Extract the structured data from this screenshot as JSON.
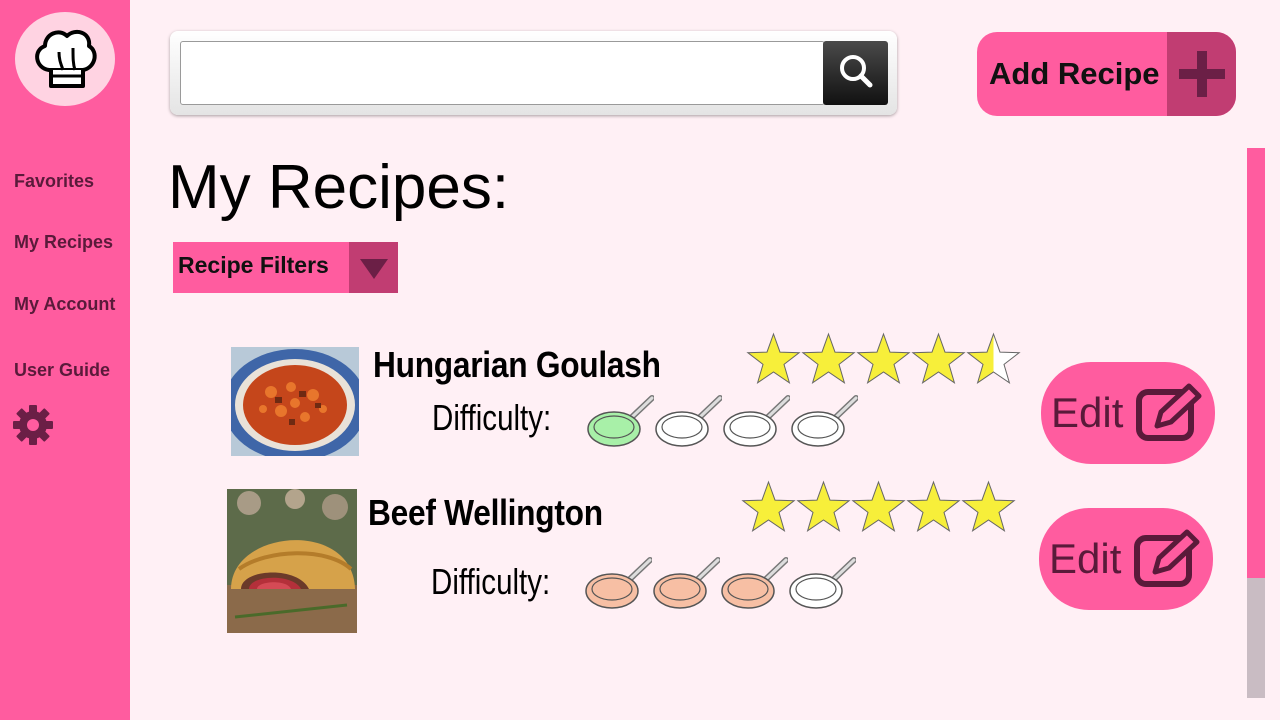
{
  "sidebar": {
    "logo": "chef-hat-icon",
    "items": [
      {
        "label": "Favorites"
      },
      {
        "label": "My Recipes"
      },
      {
        "label": "My Account"
      },
      {
        "label": "User Guide"
      }
    ],
    "settings_icon": "gear-icon"
  },
  "search": {
    "value": "",
    "placeholder": "",
    "icon": "search-icon"
  },
  "add_button": {
    "label": "Add Recipe",
    "icon": "plus-icon"
  },
  "main": {
    "title": "My Recipes:",
    "filters": {
      "label": "Recipe Filters",
      "icon": "chevron-down-icon"
    }
  },
  "recipes": [
    {
      "name": "Hungarian Goulash",
      "image": "goulash-photo",
      "rating": 4.5,
      "rating_max": 5,
      "difficulty_label": "Difficulty:",
      "difficulty": 1,
      "difficulty_max": 4,
      "difficulty_color": "#a8f0a8",
      "edit_label": "Edit",
      "edit_icon": "edit-icon"
    },
    {
      "name": "Beef Wellington",
      "image": "wellington-photo",
      "rating": 5,
      "rating_max": 5,
      "difficulty_label": "Difficulty:",
      "difficulty": 3,
      "difficulty_max": 4,
      "difficulty_color": "#f7bfa4",
      "edit_label": "Edit",
      "edit_icon": "edit-icon"
    }
  ],
  "colors": {
    "sidebar": "#ff5c9f",
    "accent_dark": "#c13d72",
    "background": "#fff0f5",
    "star": "#f7ef3a",
    "text_dark": "#5a1a3a"
  },
  "scrollbar": {
    "position_fraction": 0,
    "visible_fraction": 0.78
  }
}
